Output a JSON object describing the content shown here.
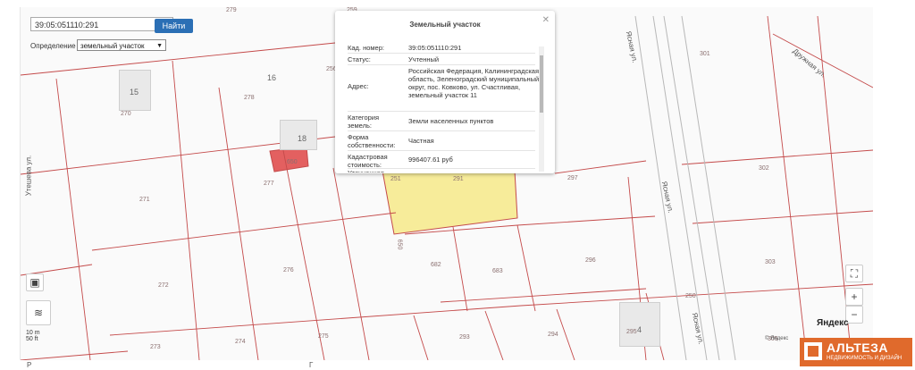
{
  "search": {
    "value": "39:05:051110:291",
    "button": "Найти"
  },
  "definition": {
    "label": "Определение",
    "selected": "земельный участок"
  },
  "popup": {
    "title": "Земельный участок",
    "rows": [
      {
        "key": "Кад. номер:",
        "value": "39:05:051110:291"
      },
      {
        "key": "Статус:",
        "value": "Учтенный"
      },
      {
        "key": "Адрес:",
        "value": "Российская Федерация, Калининградская область, Зеленоградский муниципальный округ, пос. Ковково, ул. Счастливая, земельный участок 11"
      },
      {
        "key": "Категория земель:",
        "value": "Земли населенных пунктов"
      },
      {
        "key": "Форма собственности:",
        "value": "Частная"
      },
      {
        "key": "Кадастровая стоимость:",
        "value": "996407.61 руб"
      },
      {
        "key": "Уточненная",
        "value": ""
      }
    ]
  },
  "parcels": [
    "279",
    "259",
    "256",
    "270",
    "278",
    "251",
    "291",
    "297",
    "301",
    "302",
    "271",
    "277",
    "273",
    "274",
    "275",
    "276",
    "272",
    "682",
    "683",
    "296",
    "303",
    "293",
    "294",
    "295",
    "305",
    "250",
    "650",
    "650"
  ],
  "regions": [
    "15",
    "16",
    "18",
    "4",
    "4"
  ],
  "streets": [
    "Утешева ул.",
    "Ясная ул.",
    "Ясная ул.",
    "Ясная ул.",
    "Дружная ул."
  ],
  "scale": {
    "m": "10 m",
    "ft": "50 ft"
  },
  "brand": {
    "yandex": "Яндекс",
    "copyright": "© Яндекс",
    "logo": "АЛЬТЕЗА",
    "logo_sub": "НЕДВИЖИМОСТЬ И ДИЗАЙН"
  },
  "footer": {
    "left": "Р",
    "right": "Г"
  },
  "colors": {
    "selected_parcel": "#f7ec9a",
    "highlight_parcel": "#e36060",
    "button": "#2b6fb5",
    "logo": "#e06a2c",
    "boundary": "#c44a4a"
  }
}
